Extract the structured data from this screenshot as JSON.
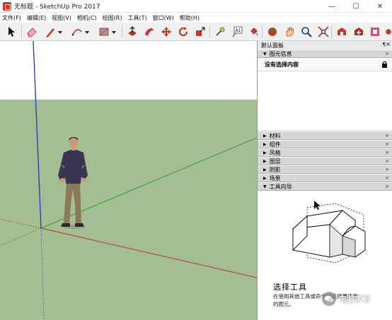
{
  "window": {
    "title": "无标题 - SketchUp Pro 2017",
    "minimize_glyph": "—",
    "maximize_glyph": "☐",
    "close_glyph": "✕"
  },
  "menu": [
    "文件(F)",
    "编辑(E)",
    "视图(V)",
    "相机(C)",
    "绘图(R)",
    "工具(T)",
    "窗口(W)",
    "帮助(H)"
  ],
  "toolbar": {
    "tools": [
      "select-icon",
      "eraser-icon",
      "pencil-line-icon",
      "arc-icon",
      "rectangle-icon",
      "push-pull-icon",
      "follow-me-icon",
      "move-icon",
      "rotate-icon",
      "scale-icon",
      "tape-measure-icon",
      "text-label-icon",
      "paint-bucket-icon",
      "orbit-icon",
      "pan-icon",
      "zoom-icon",
      "zoom-extents-icon",
      "3d-warehouse-icon",
      "extension-warehouse-icon",
      "layout-icon",
      "extension-manager-icon"
    ],
    "text_tool_glyph": "A1"
  },
  "tray": {
    "title": "默认面板",
    "pin_glyph": "¶",
    "close_glyph": "×",
    "entity_info": {
      "label": "图元信息",
      "status": "没有选择内容"
    },
    "collapsed_panels": [
      "材料",
      "组件",
      "风格",
      "图层",
      "阴影",
      "场景"
    ],
    "instructor": {
      "label": "工具向导",
      "tool_title": "选择工具",
      "description": "在使用其他工具或命令时选择要修改的图元。"
    },
    "panel_close_glyph": "×",
    "expanded_glyph": "▼",
    "collapsed_glyph": "▶"
  },
  "watermark": {
    "text": "电脑学习"
  },
  "colors": {
    "ground": "#a5bd92",
    "sky": "#ffffff",
    "axis_red": "#c0392b",
    "axis_green": "#2e9b2e",
    "axis_blue": "#2233cc"
  }
}
